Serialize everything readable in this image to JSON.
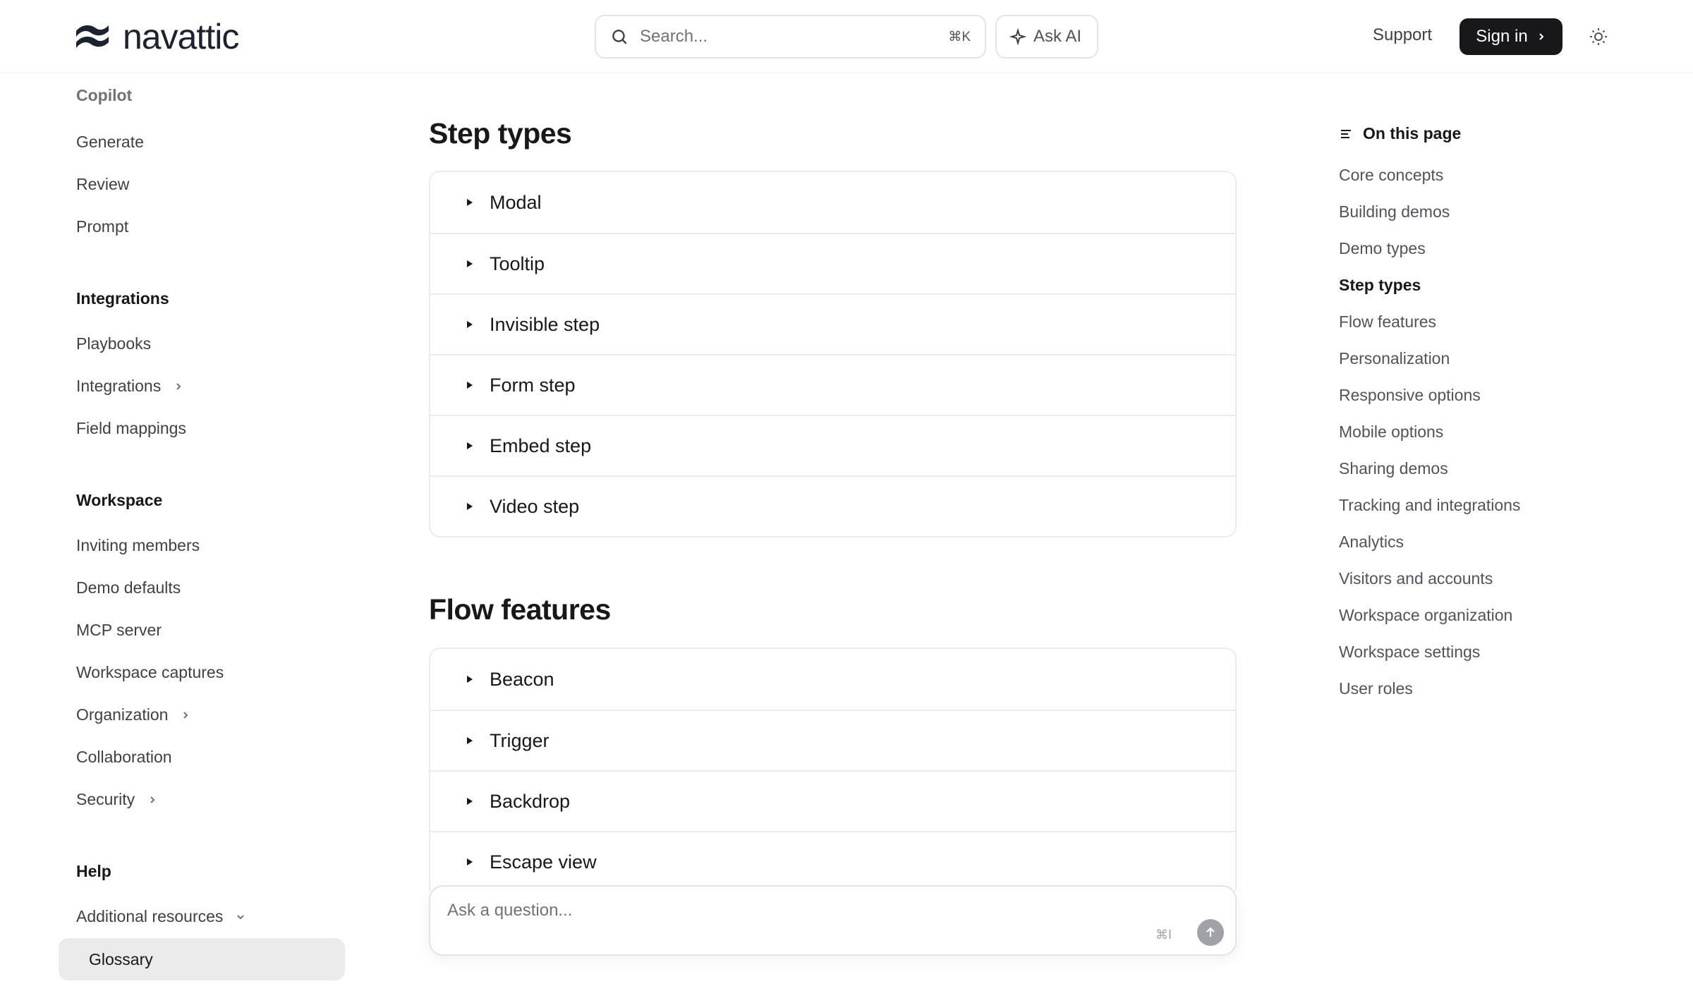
{
  "brand": {
    "name": "navattic"
  },
  "header": {
    "search_placeholder": "Search...",
    "search_shortcut": "⌘K",
    "ask_ai_label": "Ask AI",
    "support_label": "Support",
    "signin_label": "Sign in"
  },
  "sidebar": {
    "copilot_heading": "Copilot",
    "copilot_items": [
      "Generate",
      "Review",
      "Prompt"
    ],
    "integrations_heading": "Integrations",
    "integrations_items": [
      "Playbooks",
      "Integrations",
      "Field mappings"
    ],
    "workspace_heading": "Workspace",
    "workspace_items": [
      "Inviting members",
      "Demo defaults",
      "MCP server",
      "Workspace captures",
      "Organization",
      "Collaboration",
      "Security"
    ],
    "help_heading": "Help",
    "help_items": [
      "Additional resources",
      "Glossary"
    ]
  },
  "main": {
    "step_types_heading": "Step types",
    "step_types": [
      "Modal",
      "Tooltip",
      "Invisible step",
      "Form step",
      "Embed step",
      "Video step"
    ],
    "flow_features_heading": "Flow features",
    "flow_features": [
      "Beacon",
      "Trigger",
      "Backdrop",
      "Escape view"
    ],
    "ask_placeholder": "Ask a question...",
    "ask_shortcut": "⌘I"
  },
  "toc": {
    "title": "On this page",
    "items": [
      "Core concepts",
      "Building demos",
      "Demo types",
      "Step types",
      "Flow features",
      "Personalization",
      "Responsive options",
      "Mobile options",
      "Sharing demos",
      "Tracking and integrations",
      "Analytics",
      "Visitors and accounts",
      "Workspace organization",
      "Workspace settings",
      "User roles"
    ],
    "active": "Step types"
  },
  "icons": {
    "logo": "navattic-logo-icon",
    "search": "search-icon",
    "sparkle": "sparkle-icon",
    "chevron": "chevron-right-icon",
    "theme": "sun-icon",
    "toc": "list-icon",
    "caret": "caret-right-icon",
    "send": "arrow-up-icon"
  },
  "colors": {
    "accent": "#18181b",
    "active_bg": "#ebebeb",
    "border": "#ececee"
  }
}
